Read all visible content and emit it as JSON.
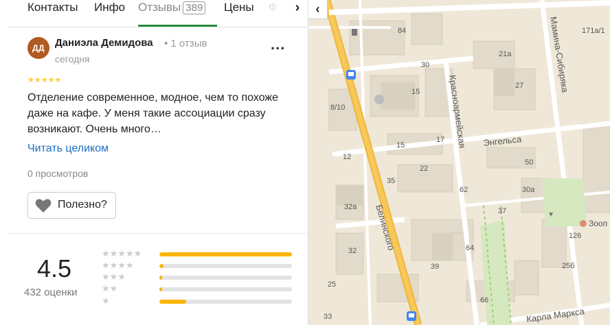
{
  "tabs": [
    {
      "label": "Контакты"
    },
    {
      "label": "Инфо"
    },
    {
      "label": "Отзывы",
      "count": "389",
      "active": true
    },
    {
      "label": "Цены"
    },
    {
      "label": "Ф"
    }
  ],
  "tab_next_glyph": "›",
  "review": {
    "avatar_initials": "ДД",
    "avatar_color": "#b15a22",
    "author": "Даниэла Демидова",
    "author_meta": "• 1 отзыв",
    "date": "сегодня",
    "more_glyph": "...",
    "stars": "★★★★★",
    "text": "Отделение современное, модное, чем то похоже даже на кафе. У меня такие ассоциации сразу возникают. Очень много…",
    "read_more": "Читать целиком",
    "views": "0 просмотров",
    "useful_label": "Полезно?"
  },
  "rating": {
    "value": "4.5",
    "count": "432 оценки",
    "distribution": [
      {
        "stars": "★★★★★",
        "fraction": 1.0
      },
      {
        "stars": "★★★★",
        "fraction": 0.03
      },
      {
        "stars": "★★★",
        "fraction": 0.02
      },
      {
        "stars": "★★",
        "fraction": 0.02
      },
      {
        "stars": "★",
        "fraction": 0.2
      }
    ],
    "bar_color": "#fab500"
  },
  "map": {
    "collapse_glyph": "‹",
    "streets": [
      "Белинского",
      "Красноармейская",
      "Энгельса",
      "Мамина-Сибиряка",
      "Карла Маркса"
    ],
    "house_numbers": [
      "84",
      "171а/1",
      "21а",
      "30",
      "27",
      "8/10",
      "15",
      "15",
      "17",
      "12",
      "50",
      "22",
      "35",
      "62",
      "30а",
      "32а",
      "37",
      "126",
      "32",
      "64",
      "39",
      "25б",
      "25",
      "66",
      "33"
    ],
    "poi_label": "Зооп"
  }
}
